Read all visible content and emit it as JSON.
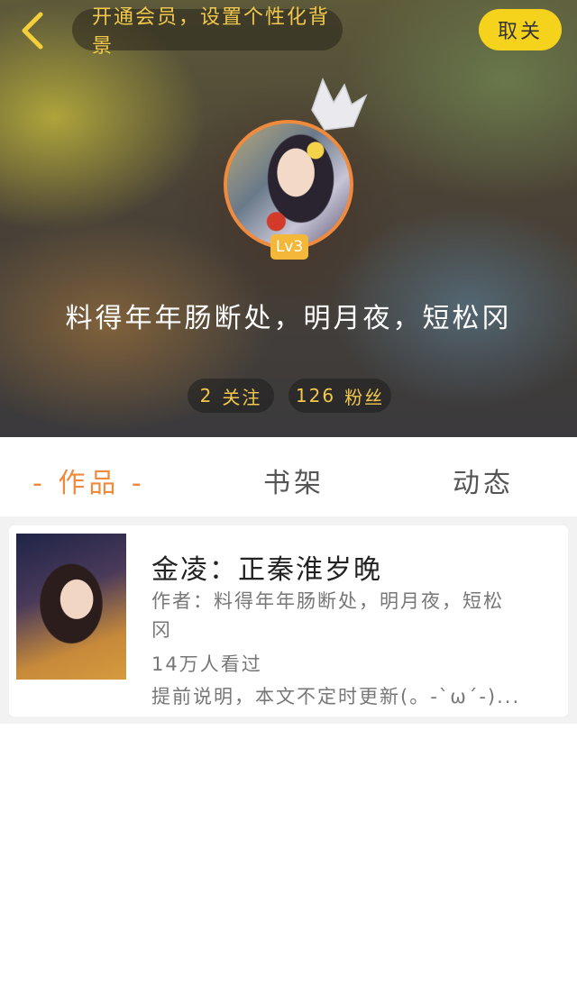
{
  "header": {
    "vip_banner": "开通会员，设置个性化背景",
    "unfollow_label": "取关",
    "level": "Lv3",
    "username": "料得年年肠断处，明月夜，短松冈",
    "stats": {
      "following_count": "2",
      "following_label": "关注",
      "fans_count": "126",
      "fans_label": "粉丝"
    }
  },
  "tabs": {
    "works": "- 作品 -",
    "shelf": "书架",
    "feed": "动态",
    "active": "works"
  },
  "works": [
    {
      "title": "金凌：正秦淮岁晚",
      "author": "作者：料得年年肠断处，明月夜，短松冈",
      "views": "14万人看过",
      "desc": "提前说明，本文不定时更新(。-`ω´-)..."
    }
  ],
  "colors": {
    "accent_orange": "#f08a3c",
    "vip_yellow": "#f2c94c",
    "button_yellow": "#f5d21c",
    "badge_gold": "#f3b73a"
  },
  "icons": {
    "back": "chevron-left-icon",
    "crown": "crown-icon"
  }
}
